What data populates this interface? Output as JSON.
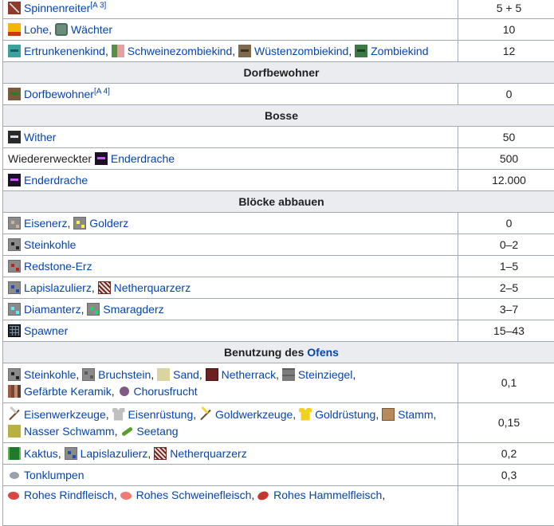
{
  "rows": {
    "spinnenreiter": {
      "label": "Spinnenreiter",
      "ref": "[A 3]",
      "value": "5 + 5"
    },
    "lohe": {
      "label1": "Lohe",
      "label2": "Wächter",
      "value": "10"
    },
    "kinder": {
      "labels": [
        "Ertrunkenenkind",
        "Schweinezombiekind",
        "Wüstenzombiekind",
        "Zombiekind"
      ],
      "value": "12"
    },
    "header_dorf": "Dorfbewohner",
    "dorfbewohner": {
      "label": "Dorfbewohner",
      "ref": "[A 4]",
      "value": "0"
    },
    "header_bosse": "Bosse",
    "wither": {
      "label": "Wither",
      "value": "50"
    },
    "wiedererweckt": {
      "prefix": "Wiedererweckter",
      "label": "Enderdrache",
      "value": "500"
    },
    "enderdrache": {
      "label": "Enderdrache",
      "value": "12.000"
    },
    "header_bloecke": "Blöcke abbauen",
    "eisenerz": {
      "label1": "Eisenerz",
      "label2": "Golderz",
      "value": "0"
    },
    "steinkohle": {
      "label": "Steinkohle",
      "value": "0–2"
    },
    "redstone": {
      "label": "Redstone-Erz",
      "value": "1–5"
    },
    "lapis": {
      "label1": "Lapislazulierz",
      "label2": "Netherquarzerz",
      "value": "2–5"
    },
    "diamant": {
      "label1": "Diamanterz",
      "label2": "Smaragderz",
      "value": "3–7"
    },
    "spawner": {
      "label": "Spawner",
      "value": "15–43"
    },
    "header_ofen_prefix": "Benutzung des",
    "header_ofen_link": "Ofens",
    "ofen1": {
      "labels": [
        "Steinkohle",
        "Bruchstein",
        "Sand",
        "Netherrack",
        "Steinziegel",
        "Gefärbte Keramik",
        "Chorusfrucht"
      ],
      "value": "0,1"
    },
    "ofen2": {
      "labels": [
        "Eisenwerkzeuge",
        "Eisenrüstung",
        "Goldwerkzeuge",
        "Goldrüstung",
        "Stamm",
        "Nasser Schwamm",
        "Seetang"
      ],
      "value": "0,15"
    },
    "ofen3": {
      "labels": [
        "Kaktus",
        "Lapislazulierz",
        "Netherquarzerz"
      ],
      "value": "0,2"
    },
    "ofen4": {
      "label": "Tonklumpen",
      "value": "0,3"
    },
    "ofen5": {
      "labels": [
        "Rohes Rindfleisch",
        "Rohes Schweinefleisch",
        "Rohes Hammelfleisch"
      ]
    }
  },
  "sep": {
    "comma": ","
  },
  "colors": {
    "link": "#0645ad",
    "header_bg": "#eaecf0",
    "border": "#a2a9b1"
  }
}
